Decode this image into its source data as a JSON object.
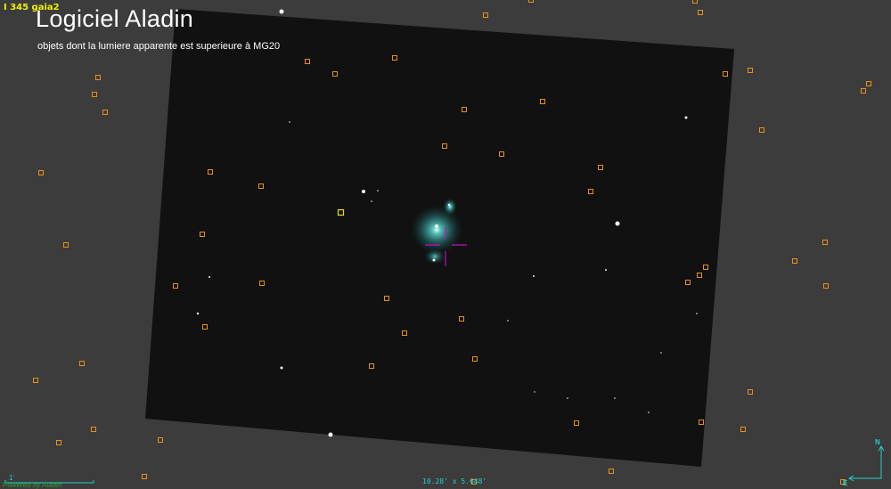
{
  "overlay": {
    "survey_label": "I 345 gaia2",
    "title": "Logiciel Aladin",
    "subtitle": "objets dont la lumiere apparente est superieure à MG20"
  },
  "status": {
    "field_of_view": "10.28' x 5.648'",
    "scale_label": "1'",
    "powered_by": "Powered by Aladin",
    "compass_north": "N",
    "compass_east": "E"
  },
  "colors": {
    "background": "#3c3c3c",
    "image": "#111111",
    "catalog_marker": "#e8901c",
    "selected_marker": "#e8e020",
    "reticle": "#c010c0",
    "overlay_cyan": "#22d0d0",
    "nebula": "#40c8c0"
  },
  "icons": [
    "catalog-source-marker-icon",
    "reticle-icon",
    "compass-icon",
    "scale-bar-icon"
  ]
}
